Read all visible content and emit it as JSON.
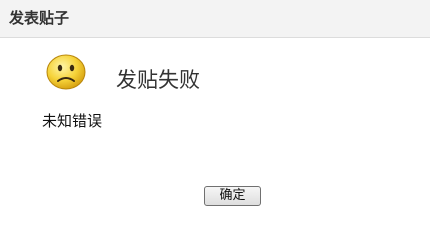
{
  "dialog": {
    "title": "发表贴子",
    "icon": "sad-face-icon",
    "message_title": "发贴失败",
    "message_detail": "未知错误",
    "ok_label": "确定"
  }
}
